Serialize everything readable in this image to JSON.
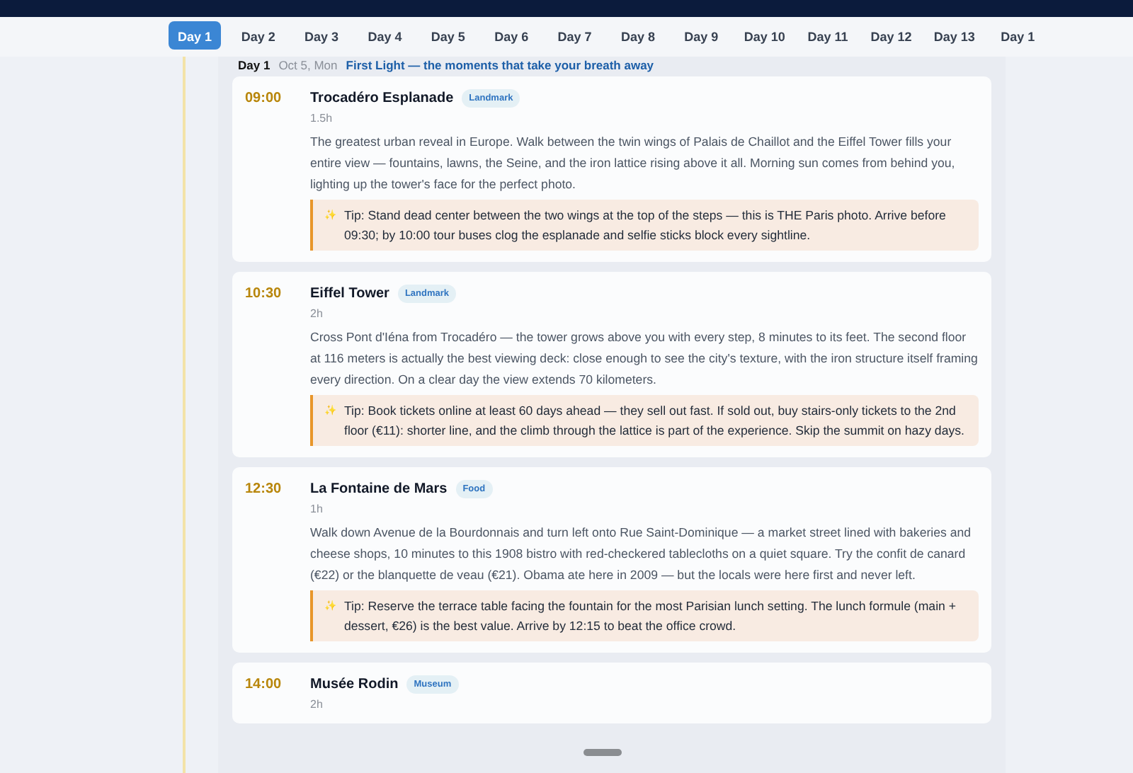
{
  "tabs": [
    {
      "label": "Day 1",
      "selected": true
    },
    {
      "label": "Day 2",
      "selected": false
    },
    {
      "label": "Day 3",
      "selected": false
    },
    {
      "label": "Day 4",
      "selected": false
    },
    {
      "label": "Day 5",
      "selected": false
    },
    {
      "label": "Day 6",
      "selected": false
    },
    {
      "label": "Day 7",
      "selected": false
    },
    {
      "label": "Day 8",
      "selected": false
    },
    {
      "label": "Day 9",
      "selected": false
    },
    {
      "label": "Day 10",
      "selected": false
    },
    {
      "label": "Day 11",
      "selected": false
    },
    {
      "label": "Day 12",
      "selected": false
    },
    {
      "label": "Day 13",
      "selected": false
    },
    {
      "label": "Day 1",
      "selected": false
    }
  ],
  "day_header": {
    "day": "Day 1",
    "date": "Oct 5, Mon",
    "theme": "First Light — the moments that take your breath away"
  },
  "tip_icon": "✨",
  "stops": [
    {
      "time": "09:00",
      "name": "Trocadéro Esplanade",
      "tag": "Landmark",
      "duration": "1.5h",
      "description": "The greatest urban reveal in Europe. Walk between the twin wings of Palais de Chaillot and the Eiffel Tower fills your entire view — fountains, lawns, the Seine, and the iron lattice rising above it all. Morning sun comes from behind you, lighting up the tower's face for the perfect photo.",
      "tip": "Tip: Stand dead center between the two wings at the top of the steps — this is THE Paris photo. Arrive before 09:30; by 10:00 tour buses clog the esplanade and selfie sticks block every sightline."
    },
    {
      "time": "10:30",
      "name": "Eiffel Tower",
      "tag": "Landmark",
      "duration": "2h",
      "description": "Cross Pont d'Iéna from Trocadéro — the tower grows above you with every step, 8 minutes to its feet. The second floor at 116 meters is actually the best viewing deck: close enough to see the city's texture, with the iron structure itself framing every direction. On a clear day the view extends 70 kilometers.",
      "tip": "Tip: Book tickets online at least 60 days ahead — they sell out fast. If sold out, buy stairs-only tickets to the 2nd floor (€11): shorter line, and the climb through the lattice is part of the experience. Skip the summit on hazy days."
    },
    {
      "time": "12:30",
      "name": "La Fontaine de Mars",
      "tag": "Food",
      "duration": "1h",
      "description": "Walk down Avenue de la Bourdonnais and turn left onto Rue Saint-Dominique — a market street lined with bakeries and cheese shops, 10 minutes to this 1908 bistro with red-checkered tablecloths on a quiet square. Try the confit de canard (€22) or the blanquette de veau (€21). Obama ate here in 2009 — but the locals were here first and never left.",
      "tip": "Tip: Reserve the terrace table facing the fountain for the most Parisian lunch setting. The lunch formule (main + dessert, €26) is the best value. Arrive by 12:15 to beat the office crowd."
    },
    {
      "time": "14:00",
      "name": "Musée Rodin",
      "tag": "Museum",
      "duration": "2h"
    }
  ]
}
